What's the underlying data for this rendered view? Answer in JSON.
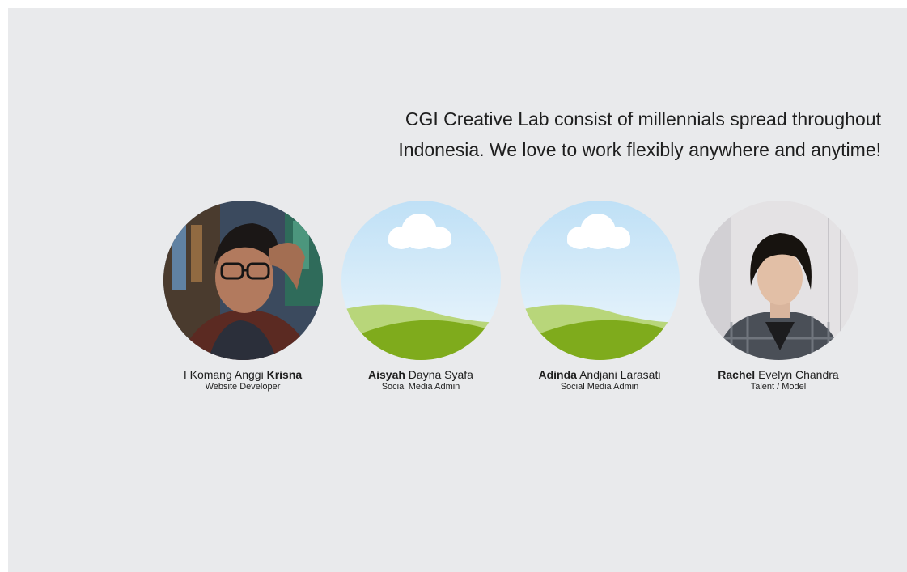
{
  "intro": {
    "line1": "CGI Creative Lab consist of millennials spread throughout",
    "line2": "Indonesia. We love to work flexibly anywhere and anytime!"
  },
  "members": [
    {
      "name_regular_1": "I Komang Anggi ",
      "name_bold": "Krisna",
      "name_regular_2": "",
      "role": "Website Developer",
      "avatar": "photo-man-glasses"
    },
    {
      "name_regular_1": "",
      "name_bold": "Aisyah",
      "name_regular_2": " Dayna Syafa",
      "role": "Social Media Admin",
      "avatar": "placeholder-landscape-icon"
    },
    {
      "name_regular_1": "",
      "name_bold": "Adinda",
      "name_regular_2": " Andjani Larasati",
      "role": "Social Media Admin",
      "avatar": "placeholder-landscape-icon"
    },
    {
      "name_regular_1": "",
      "name_bold": "Rachel",
      "name_regular_2": " Evelyn Chandra",
      "role": "Talent / Model",
      "avatar": "photo-woman-plaid"
    }
  ],
  "colors": {
    "background": "#e9eaec",
    "text": "#1e1e1e",
    "sky": "#cfe7f7",
    "hill_light": "#b8d67a",
    "hill_dark": "#7fab1c"
  }
}
